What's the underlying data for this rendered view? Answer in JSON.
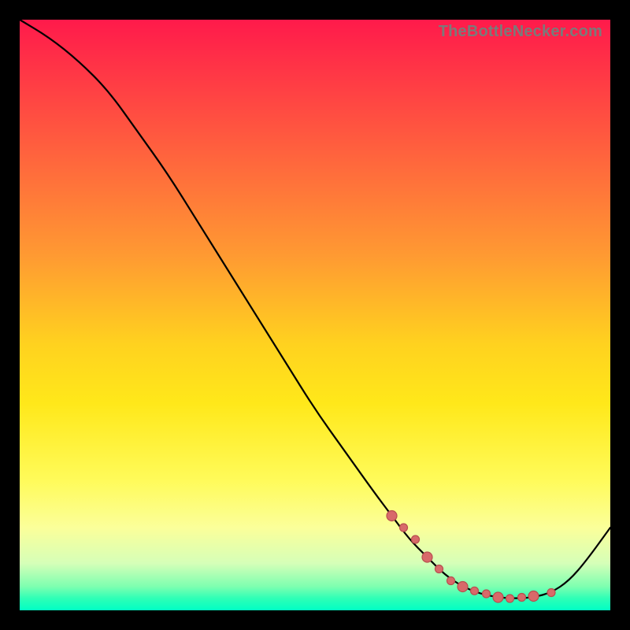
{
  "watermark": "TheBottleNecker.com",
  "colors": {
    "page_bg": "#000000",
    "gradient_top": "#ff1a4b",
    "gradient_bottom": "#00ffc4",
    "curve": "#000000",
    "dot_fill": "#d86a6a",
    "dot_stroke": "#b84f4f"
  },
  "chart_data": {
    "type": "line",
    "title": "",
    "xlabel": "",
    "ylabel": "",
    "xlim": [
      0,
      100
    ],
    "ylim": [
      0,
      100
    ],
    "note": "Both axes are percent of plot-area extent. y=0 is the bottom of the gradient (green band), y=100 is the top (red). The curve is a bottleneck-style profile: starts at top-left, descends roughly linearly, flattens in a valley near x≈70–88, then climbs toward the right edge.",
    "series": [
      {
        "name": "bottleneck-curve",
        "x": [
          0,
          5,
          10,
          15,
          20,
          25,
          30,
          35,
          40,
          45,
          50,
          55,
          60,
          63,
          66,
          69,
          72,
          75,
          78,
          81,
          84,
          87,
          90,
          93,
          96,
          100
        ],
        "y": [
          100,
          97,
          93,
          88,
          81,
          74,
          66,
          58,
          50,
          42,
          34,
          27,
          20,
          16,
          12,
          9,
          6,
          4,
          2.8,
          2.2,
          2.0,
          2.2,
          3.0,
          5.0,
          8.5,
          14
        ]
      }
    ],
    "highlight_points": {
      "name": "valley-dots",
      "note": "Clustered salmon dots along the curve near the valley minimum (x≈63–90).",
      "x": [
        63,
        65,
        67,
        69,
        71,
        73,
        75,
        77,
        79,
        81,
        83,
        85,
        87,
        90
      ],
      "y": [
        16,
        14,
        12,
        9,
        7,
        5,
        4,
        3.3,
        2.8,
        2.2,
        2.0,
        2.2,
        2.4,
        3.0
      ]
    }
  }
}
